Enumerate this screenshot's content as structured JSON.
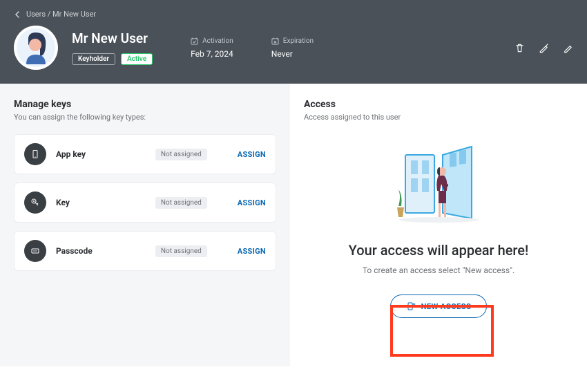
{
  "breadcrumb": {
    "path": "Users / Mr New User"
  },
  "user": {
    "name": "Mr New User",
    "role_badge": "Keyholder",
    "status_badge": "Active"
  },
  "meta": {
    "activation_label": "Activation",
    "activation_value": "Feb 7, 2024",
    "expiration_label": "Expiration",
    "expiration_value": "Never"
  },
  "manage_keys": {
    "title": "Manage keys",
    "subtitle": "You can assign the following key types:",
    "items": [
      {
        "name": "App key",
        "status": "Not assigned",
        "action": "ASSIGN"
      },
      {
        "name": "Key",
        "status": "Not assigned",
        "action": "ASSIGN"
      },
      {
        "name": "Passcode",
        "status": "Not assigned",
        "action": "ASSIGN"
      }
    ]
  },
  "access": {
    "title": "Access",
    "subtitle": "Access assigned to this user",
    "empty_title": "Your access will appear here!",
    "empty_sub": "To create an access select \"New access\".",
    "new_access_label": "NEW ACCESS"
  }
}
